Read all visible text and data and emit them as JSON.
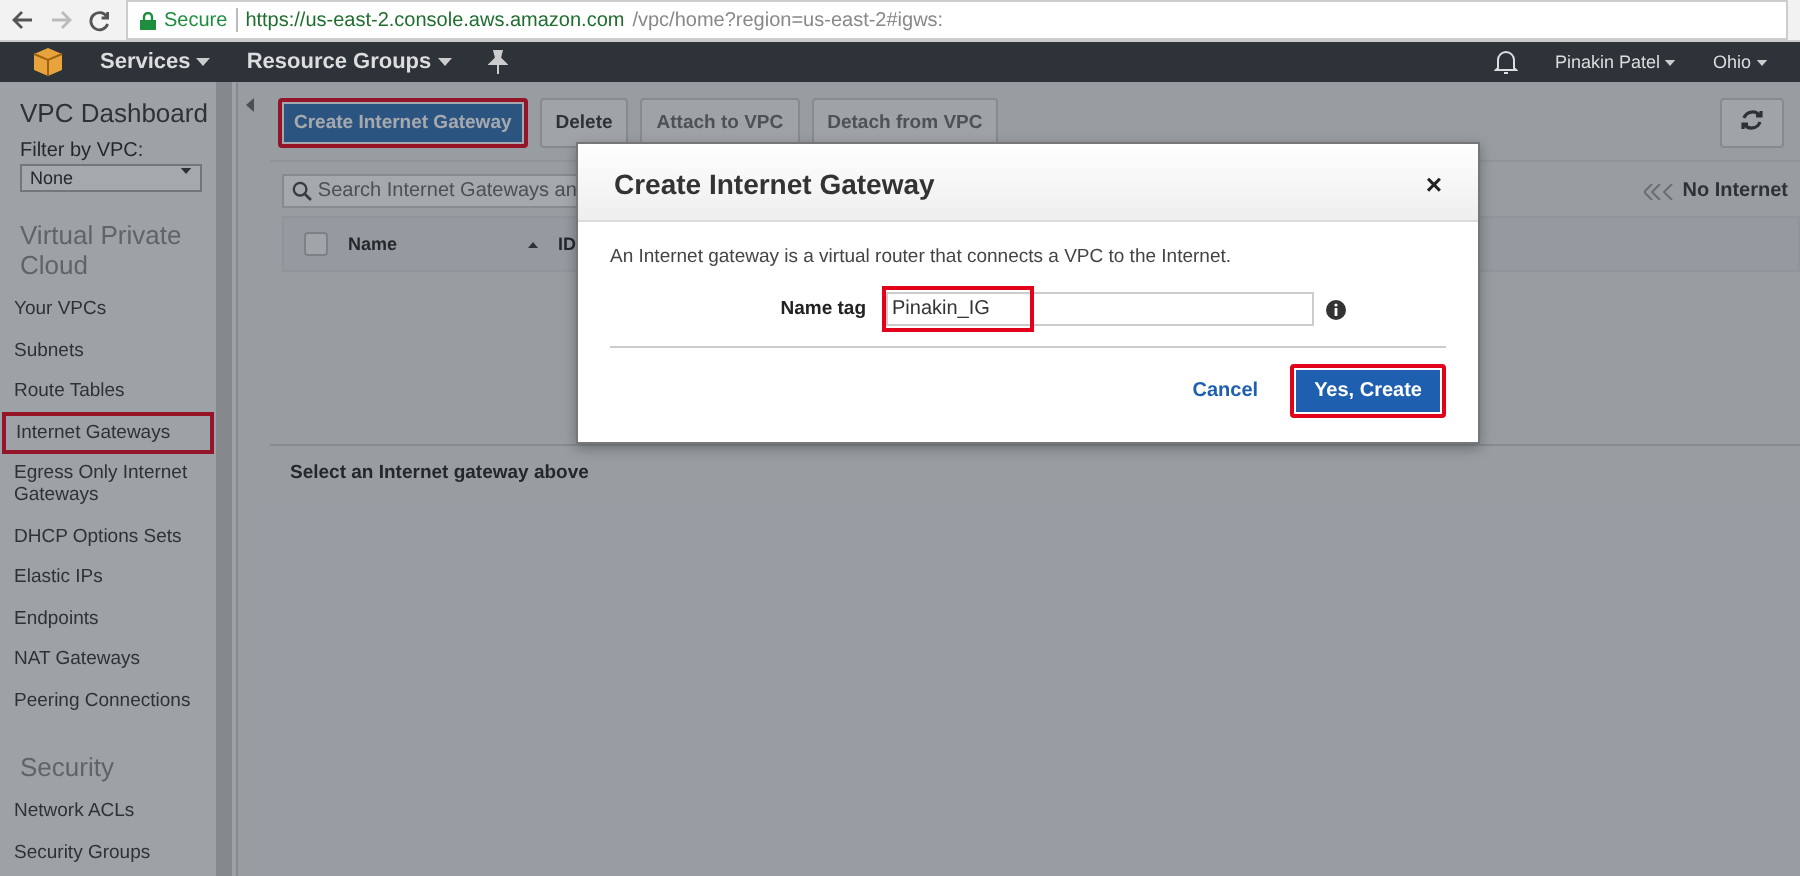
{
  "browser": {
    "secure_label": "Secure",
    "url_host": "https://us-east-2.console.aws.amazon.com",
    "url_path": "/vpc/home?region=us-east-2#igws:"
  },
  "nav": {
    "menus": [
      "Services",
      "Resource Groups"
    ],
    "user": "Pinakin Patel",
    "region": "Ohio"
  },
  "sidebar": {
    "title": "VPC Dashboard",
    "filter_label": "Filter by VPC:",
    "filter_value": "None",
    "sections": [
      {
        "heading": "Virtual Private Cloud",
        "items": [
          {
            "label": "Your VPCs",
            "highlighted": false
          },
          {
            "label": "Subnets",
            "highlighted": false
          },
          {
            "label": "Route Tables",
            "highlighted": false
          },
          {
            "label": "Internet Gateways",
            "highlighted": true
          },
          {
            "label": "Egress Only Internet Gateways",
            "highlighted": false
          },
          {
            "label": "DHCP Options Sets",
            "highlighted": false
          },
          {
            "label": "Elastic IPs",
            "highlighted": false
          },
          {
            "label": "Endpoints",
            "highlighted": false
          },
          {
            "label": "NAT Gateways",
            "highlighted": false
          },
          {
            "label": "Peering Connections",
            "highlighted": false
          }
        ]
      },
      {
        "heading": "Security",
        "items": [
          {
            "label": "Network ACLs",
            "highlighted": false
          },
          {
            "label": "Security Groups",
            "highlighted": false
          }
        ]
      }
    ]
  },
  "toolbar": [
    {
      "label": "Create Internet Gateway",
      "kind": "primary",
      "disabled": false,
      "highlighted": true
    },
    {
      "label": "Delete",
      "kind": "default",
      "disabled": false,
      "highlighted": false
    },
    {
      "label": "Attach to VPC",
      "kind": "default",
      "disabled": true,
      "highlighted": false
    },
    {
      "label": "Detach from VPC",
      "kind": "default",
      "disabled": true,
      "highlighted": false
    }
  ],
  "search": {
    "placeholder": "Search Internet Gateways an"
  },
  "pager": "No Internet",
  "table": {
    "select_all_checked": false,
    "columns": [
      "Name",
      "ID"
    ]
  },
  "detail_hint": "Select an Internet gateway above",
  "dialog": {
    "title": "Create Internet Gateway",
    "close": "×",
    "description": "An Internet gateway is a virtual router that connects a VPC to the Internet.",
    "field_label": "Name tag",
    "field_value": "Pinakin_IG",
    "field_highlighted": true,
    "buttons": [
      {
        "label": "Cancel",
        "kind": "link",
        "highlighted": false
      },
      {
        "label": "Yes, Create",
        "kind": "primary",
        "highlighted": true
      }
    ]
  }
}
